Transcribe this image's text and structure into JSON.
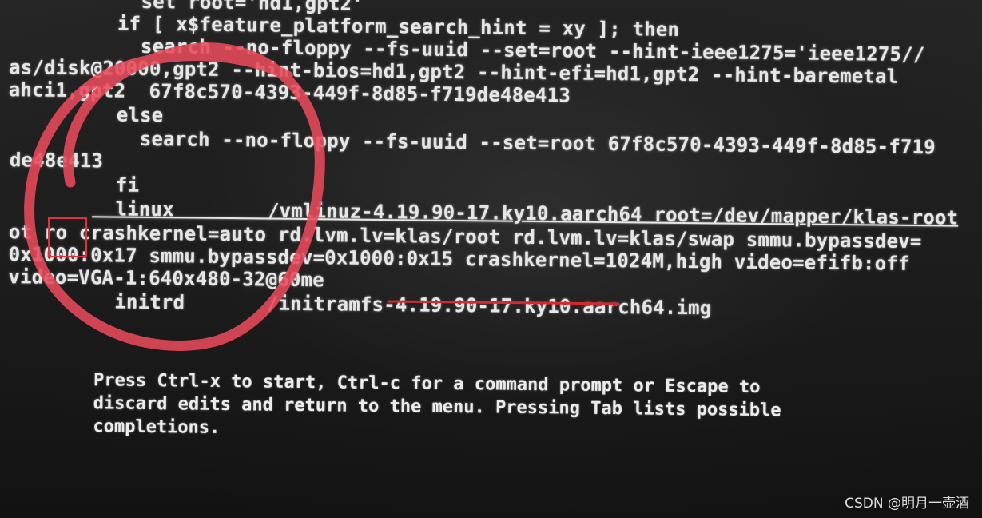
{
  "terminal": {
    "lines": [
      "    search --no-floppy --fs-uuid --set=root --hint-ieee1275='ieee1275//",
      "as/disk@20000,gpt2 --hint-bios=hd1,gpt2 --hint-efi=hd1,gpt2 --hint-baremetal",
      "ahci1,gpt2  67f8c570-4393-449f-8d85-f719de48e413",
      "  else",
      "    search --no-floppy --fs-uuid --set=root 67f8c570-4393-449f-8d85-f719",
      "de48e413",
      "  fi",
      "  linux        /vmlinuz-4.19.90-17.ky10.aarch64 root=/dev/mapper/klas-root",
      "ot ro crashkernel=auto rd.lvm.lv=klas/root rd.lvm.lv=klas/swap smmu.bypassdev=",
      "0x1000:0x17 smmu.bypassdev=0x1000:0x15 crashkernel=1024M,high video=efifb:off",
      "video=VGA-1:640x480-32@60me",
      "  initrd       /initramfs-4.19.90-17.ky10.aarch64.img"
    ],
    "top_partial_1": "    set root='hd1,gpt2'",
    "top_partial_2": "  if [ x$feature_platform_search_hint = xy ]; then",
    "help": [
      "Press Ctrl-x to start, Ctrl-c for a command prompt or Escape to",
      "discard edits and return to the menu. Pressing Tab lists possible",
      "completions."
    ]
  },
  "annotation": {
    "circle_color": "#e84a5a",
    "box_color": "#e0313f",
    "underline_color": "#d9272f"
  },
  "watermark": "CSDN @明月一壶酒"
}
